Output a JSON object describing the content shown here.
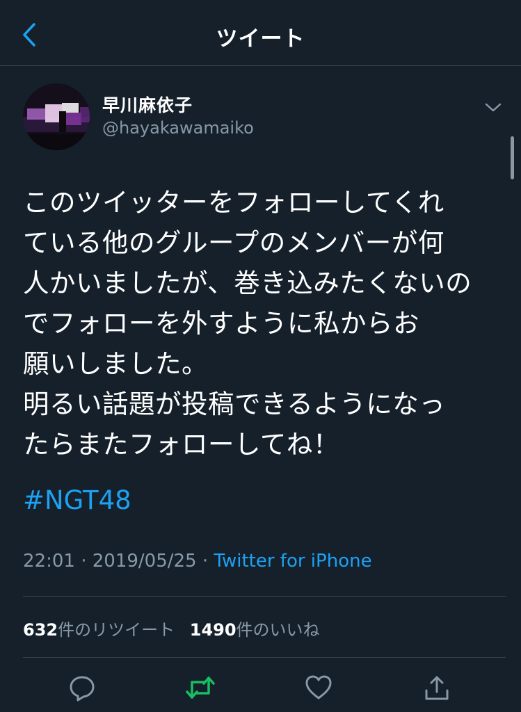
{
  "header": {
    "title": "ツイート",
    "back_icon": "chevron-left-icon"
  },
  "author": {
    "display_name": "早川麻依子",
    "handle": "@hayakawamaiko"
  },
  "tweet": {
    "text": "このツイッターをフォローしてくれ\nている他のグループのメンバーが何\n人かいましたが、巻き込みたくないの\nでフォローを外すように私からお\n願いしました。\n明るい話題が投稿できるようになっ\nたらまたフォローしてね！",
    "hashtag": "#NGT48",
    "time": "22:01",
    "date": "2019/05/25",
    "separator": "·",
    "source": "Twitter for iPhone"
  },
  "stats": {
    "retweets_count": "632",
    "retweets_label": "件のリツイート",
    "likes_count": "1490",
    "likes_label": "件のいいね"
  },
  "actions": [
    {
      "name": "reply",
      "icon": "reply-icon"
    },
    {
      "name": "retweet",
      "icon": "retweet-icon"
    },
    {
      "name": "like",
      "icon": "heart-icon"
    },
    {
      "name": "share",
      "icon": "share-icon"
    }
  ],
  "colors": {
    "background": "#15202b",
    "accent": "#1da1f2",
    "retweet": "#17bf63",
    "muted": "#8899a6",
    "divider": "#38444d"
  }
}
